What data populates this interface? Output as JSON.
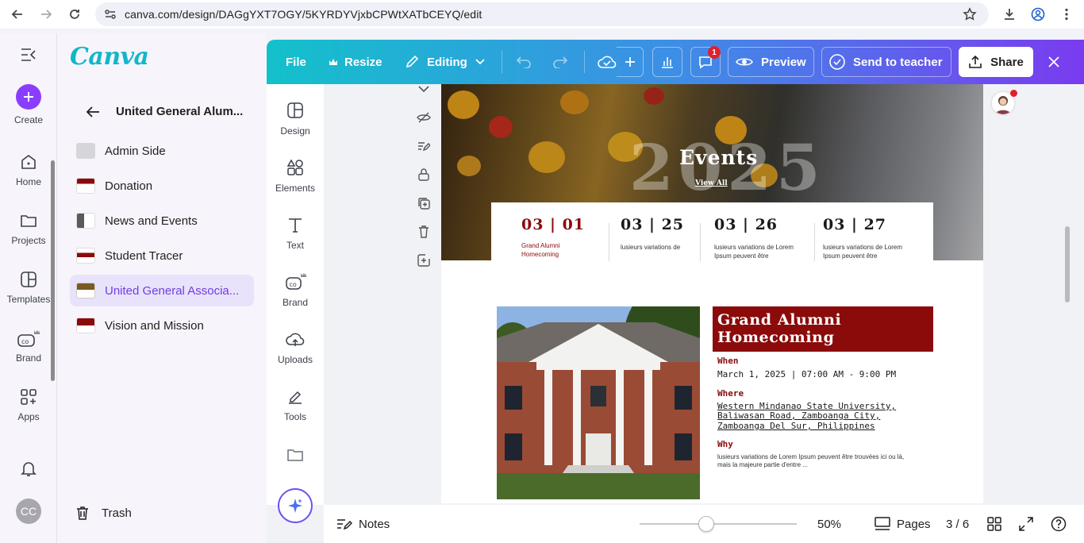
{
  "browser": {
    "url": "canva.com/design/DAGgYXT7OGY/5KYRDYVjxbCPWtXATbCEYQ/edit"
  },
  "rail": {
    "items": [
      {
        "label": "Create",
        "icon": "plus-icon"
      },
      {
        "label": "Home",
        "icon": "home-icon"
      },
      {
        "label": "Projects",
        "icon": "folder-icon"
      },
      {
        "label": "Templates",
        "icon": "templates-icon"
      },
      {
        "label": "Brand",
        "icon": "brand-icon"
      },
      {
        "label": "Apps",
        "icon": "apps-icon"
      }
    ],
    "avatar_initials": "CC"
  },
  "panel": {
    "logo": "Canva",
    "title": "United General Alum...",
    "pages": [
      {
        "label": "Admin Side",
        "active": false
      },
      {
        "label": "Donation",
        "active": false
      },
      {
        "label": "News and Events",
        "active": false
      },
      {
        "label": "Student Tracer",
        "active": false
      },
      {
        "label": "United General Associa...",
        "active": true
      },
      {
        "label": "Vision and Mission",
        "active": false
      }
    ],
    "trash_label": "Trash"
  },
  "topbar": {
    "file": "File",
    "resize": "Resize",
    "editing": "Editing",
    "comments_badge": "1",
    "preview": "Preview",
    "send_to_teacher": "Send to teacher",
    "share": "Share"
  },
  "tools": [
    {
      "label": "Design",
      "icon": "design-icon"
    },
    {
      "label": "Elements",
      "icon": "elements-icon"
    },
    {
      "label": "Text",
      "icon": "text-icon"
    },
    {
      "label": "Brand",
      "icon": "brand-icon"
    },
    {
      "label": "Uploads",
      "icon": "uploads-icon"
    },
    {
      "label": "Tools",
      "icon": "tools-icon"
    }
  ],
  "canvas": {
    "hero_year": "2025",
    "hero_title": "Events",
    "view_all": "View All",
    "dates": [
      {
        "date": "03 | 01",
        "desc": "Grand Alumni Homecoming"
      },
      {
        "date": "03 | 25",
        "desc": "lusieurs variations de"
      },
      {
        "date": "03 | 26",
        "desc": "lusieurs variations de Lorem Ipsum peuvent être"
      },
      {
        "date": "03 | 27",
        "desc": "lusieurs variations de Lorem Ipsum peuvent être"
      }
    ],
    "event": {
      "title": "Grand Alumni Homecoming",
      "when_label": "When",
      "when_text": "March 1, 2025 | 07:00 AM - 9:00 PM",
      "where_label": "Where",
      "where_line1": "Western Mindanao State University,",
      "where_line2": "Baliwasan Road, Zamboanga City,",
      "where_line3": "Zamboanga Del Sur, Philippines",
      "why_label": "Why",
      "why_text": "lusieurs variations de Lorem Ipsum peuvent être trouvées ici ou là, mais la majeure partie d'entre ..."
    }
  },
  "bottombar": {
    "notes": "Notes",
    "zoom": "50%",
    "pages_label": "Pages",
    "page_count": "3 / 6"
  },
  "colors": {
    "brand_purple": "#8b3dff",
    "event_red": "#8b0b0b",
    "logo_teal": "#10b7c9"
  }
}
